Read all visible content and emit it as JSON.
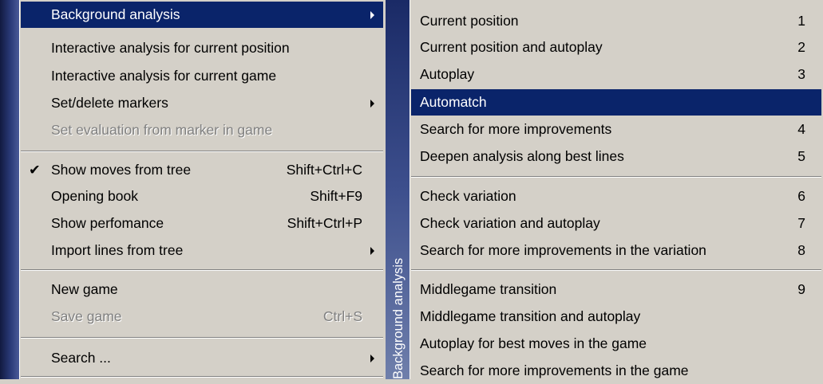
{
  "left_menu": {
    "strip_color": "#2a3a78",
    "items": [
      {
        "label": "Background analysis",
        "shortcut": "",
        "submenu": true,
        "highlighted": true,
        "disabled": false,
        "checked": false
      },
      {
        "label": "Interactive analysis for current position",
        "shortcut": "",
        "submenu": false,
        "highlighted": false,
        "disabled": false,
        "checked": false
      },
      {
        "label": "Interactive analysis for current game",
        "shortcut": "",
        "submenu": false,
        "highlighted": false,
        "disabled": false,
        "checked": false
      },
      {
        "label": "Set/delete markers",
        "shortcut": "",
        "submenu": true,
        "highlighted": false,
        "disabled": false,
        "checked": false
      },
      {
        "label": "Set evaluation from marker in game",
        "shortcut": "",
        "submenu": false,
        "highlighted": false,
        "disabled": true,
        "checked": false
      },
      {
        "label": "Show moves from tree",
        "shortcut": "Shift+Ctrl+C",
        "submenu": false,
        "highlighted": false,
        "disabled": false,
        "checked": true
      },
      {
        "label": "Opening book",
        "shortcut": "Shift+F9",
        "submenu": false,
        "highlighted": false,
        "disabled": false,
        "checked": false
      },
      {
        "label": "Show perfomance",
        "shortcut": "Shift+Ctrl+P",
        "submenu": false,
        "highlighted": false,
        "disabled": false,
        "checked": false
      },
      {
        "label": "Import lines from tree",
        "shortcut": "",
        "submenu": true,
        "highlighted": false,
        "disabled": false,
        "checked": false
      },
      {
        "label": "New game",
        "shortcut": "",
        "submenu": false,
        "highlighted": false,
        "disabled": false,
        "checked": false
      },
      {
        "label": "Save game",
        "shortcut": "Ctrl+S",
        "submenu": false,
        "highlighted": false,
        "disabled": true,
        "checked": false
      },
      {
        "label": "Search ...",
        "shortcut": "",
        "submenu": true,
        "highlighted": false,
        "disabled": false,
        "checked": false
      }
    ],
    "check_glyph": "✔"
  },
  "submenu": {
    "caption": "Background analysis",
    "highlight_color": "#0a246a",
    "items": [
      {
        "label": "Current position",
        "shortcut": "1",
        "highlighted": false
      },
      {
        "label": "Current position and autoplay",
        "shortcut": "2",
        "highlighted": false
      },
      {
        "label": "Autoplay",
        "shortcut": "3",
        "highlighted": false
      },
      {
        "label": "Automatch",
        "shortcut": "",
        "highlighted": true
      },
      {
        "label": "Search for more improvements",
        "shortcut": "4",
        "highlighted": false
      },
      {
        "label": "Deepen analysis along best lines",
        "shortcut": "5",
        "highlighted": false
      },
      {
        "label": "Check variation",
        "shortcut": "6",
        "highlighted": false
      },
      {
        "label": "Check variation and autoplay",
        "shortcut": "7",
        "highlighted": false
      },
      {
        "label": "Search for more improvements in the variation",
        "shortcut": "8",
        "highlighted": false
      },
      {
        "label": "Middlegame transition",
        "shortcut": "9",
        "highlighted": false
      },
      {
        "label": "Middlegame transition and autoplay",
        "shortcut": "",
        "highlighted": false
      },
      {
        "label": "Autoplay for best moves in the game",
        "shortcut": "",
        "highlighted": false
      },
      {
        "label": "Search for more improvements in the game",
        "shortcut": "",
        "highlighted": false
      }
    ]
  }
}
